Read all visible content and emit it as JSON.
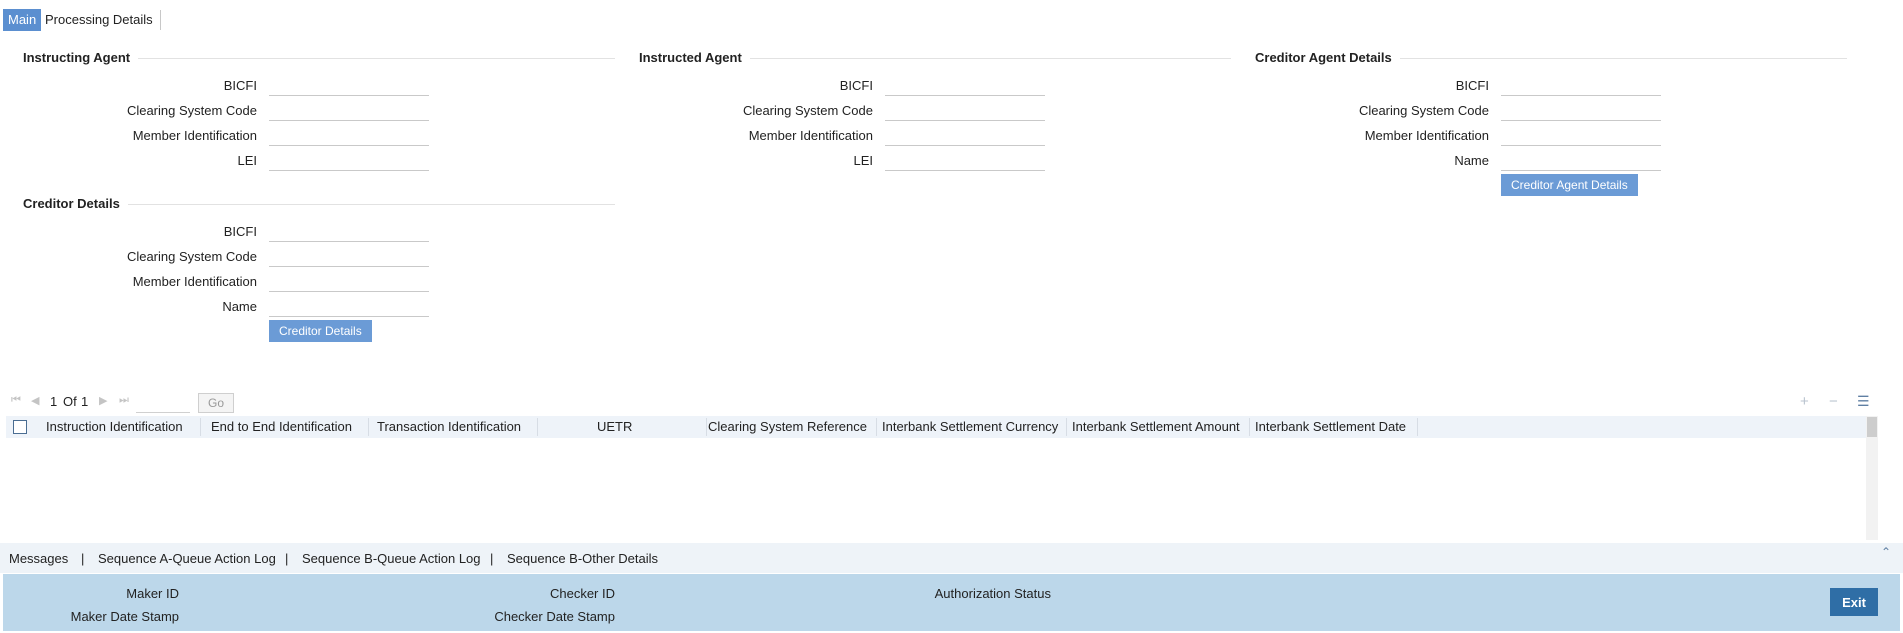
{
  "tabs": [
    {
      "label": "Main",
      "active": true
    },
    {
      "label": "Processing Details",
      "active": false
    }
  ],
  "instructing_agent": {
    "title": "Instructing Agent",
    "fields": [
      "BICFI",
      "Clearing System Code",
      "Member Identification",
      "LEI"
    ]
  },
  "instructed_agent": {
    "title": "Instructed Agent",
    "fields": [
      "BICFI",
      "Clearing System Code",
      "Member Identification",
      "LEI"
    ]
  },
  "creditor_agent": {
    "title": "Creditor Agent Details",
    "fields": [
      "BICFI",
      "Clearing System Code",
      "Member Identification",
      "Name"
    ],
    "button": "Creditor Agent Details"
  },
  "creditor": {
    "title": "Creditor Details",
    "fields": [
      "BICFI",
      "Clearing System Code",
      "Member Identification",
      "Name"
    ],
    "button": "Creditor Details"
  },
  "grid": {
    "pager": {
      "current": "1",
      "of_label": "Of",
      "total": "1"
    },
    "go_label": "Go",
    "columns": [
      "Instruction Identification",
      "End to End Identification",
      "Transaction Identification",
      "UETR",
      "Clearing System Reference",
      "Interbank Settlement Currency",
      "Interbank Settlement Amount",
      "Interbank Settlement Date"
    ],
    "icons": [
      "plus-icon",
      "minus-icon",
      "column-list-icon"
    ]
  },
  "bottom_links": [
    "Messages",
    "Sequence A-Queue Action Log",
    "Sequence B-Queue Action Log",
    "Sequence B-Other Details"
  ],
  "link_separator": "|",
  "audit": {
    "maker_id": "Maker ID",
    "maker_date": "Maker Date Stamp",
    "checker_id": "Checker ID",
    "checker_date": "Checker Date Stamp",
    "auth_status": "Authorization Status",
    "exit": "Exit"
  },
  "colors": {
    "tab_active": "#5b8fd0",
    "button": "#6b9bd6",
    "audit_bg": "#bcd7ea",
    "exit_button": "#2f6ea6"
  }
}
